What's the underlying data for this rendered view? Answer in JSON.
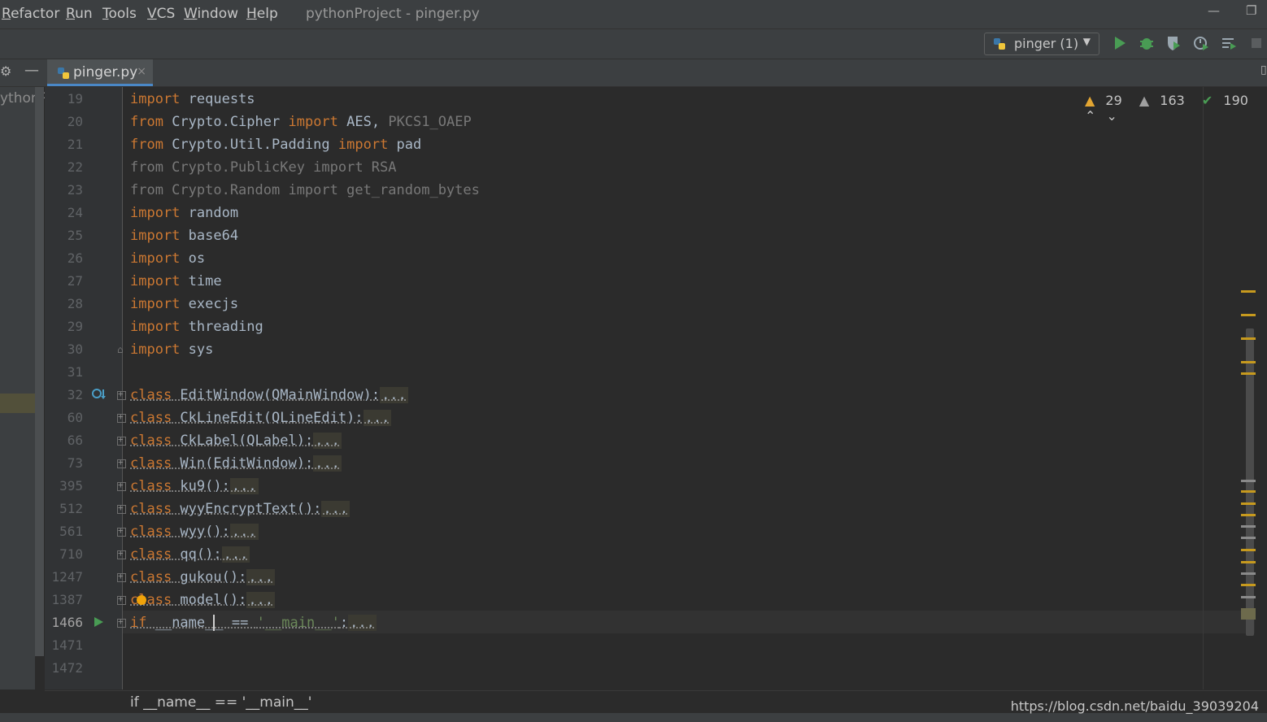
{
  "menu": {
    "items": [
      "Refactor",
      "Run",
      "Tools",
      "VCS",
      "Window",
      "Help"
    ],
    "title": "pythonProject - pinger.py"
  },
  "toolbar": {
    "run_config": "pinger (1)",
    "icons": [
      "run-icon",
      "debug-icon",
      "coverage-icon",
      "profile-icon",
      "build-icon",
      "stop-icon"
    ]
  },
  "tab": {
    "filename": "pinger.py",
    "close": "×"
  },
  "project_pane": {
    "label": "ythonP"
  },
  "inspections": {
    "warnings": "29",
    "weak_warnings": "163",
    "typos": "190"
  },
  "code_lines": [
    {
      "num": "19"
    },
    {
      "num": "20"
    },
    {
      "num": "21"
    },
    {
      "num": "22"
    },
    {
      "num": "23"
    },
    {
      "num": "24"
    },
    {
      "num": "25"
    },
    {
      "num": "26"
    },
    {
      "num": "27"
    },
    {
      "num": "28"
    },
    {
      "num": "29"
    },
    {
      "num": "30"
    },
    {
      "num": "31"
    },
    {
      "num": "32"
    },
    {
      "num": "60"
    },
    {
      "num": "66"
    },
    {
      "num": "73"
    },
    {
      "num": "395"
    },
    {
      "num": "512"
    },
    {
      "num": "561"
    },
    {
      "num": "710"
    },
    {
      "num": "1247"
    },
    {
      "num": "1387"
    },
    {
      "num": "1466"
    },
    {
      "num": "1471"
    },
    {
      "num": "1472"
    }
  ],
  "code": {
    "l19": [
      "import",
      " requests"
    ],
    "l20": [
      "from",
      " Crypto.Cipher ",
      "import",
      " AES, ",
      "PKCS1_OAEP"
    ],
    "l21": [
      "from",
      " Crypto.Util.Padding ",
      "import",
      " pad"
    ],
    "l22": "from Crypto.PublicKey import RSA",
    "l23": "from Crypto.Random import get_random_bytes",
    "l24": [
      "import",
      " random"
    ],
    "l25": [
      "import",
      " base64"
    ],
    "l26": [
      "import",
      " os"
    ],
    "l27": [
      "import",
      " time"
    ],
    "l28": [
      "import",
      " execjs"
    ],
    "l29": [
      "import",
      " threading"
    ],
    "l30": [
      "import",
      " sys"
    ],
    "l32": [
      "class",
      " EditWindow(QMainWindow):"
    ],
    "l60": [
      "class",
      " CkLineEdit(QLineEdit):"
    ],
    "l66": [
      "class",
      " CkLabel(QLabel):"
    ],
    "l73": [
      "class",
      " Win(EditWindow):"
    ],
    "l395": [
      "class",
      " ku9():"
    ],
    "l512": [
      "class",
      " wyyEncryptText():"
    ],
    "l561": [
      "class",
      " wyy():"
    ],
    "l710": [
      "class",
      " qq():"
    ],
    "l1247": [
      "class",
      " gukou():"
    ],
    "l1387": [
      "class",
      " model():"
    ],
    "l1466": [
      "if",
      " __name_",
      "_ == ",
      "'__main__'",
      ":"
    ],
    "dots": "..."
  },
  "breadcrumb": "if __name__ == '__main__'",
  "watermark": "https://blog.csdn.net/baidu_39039204"
}
